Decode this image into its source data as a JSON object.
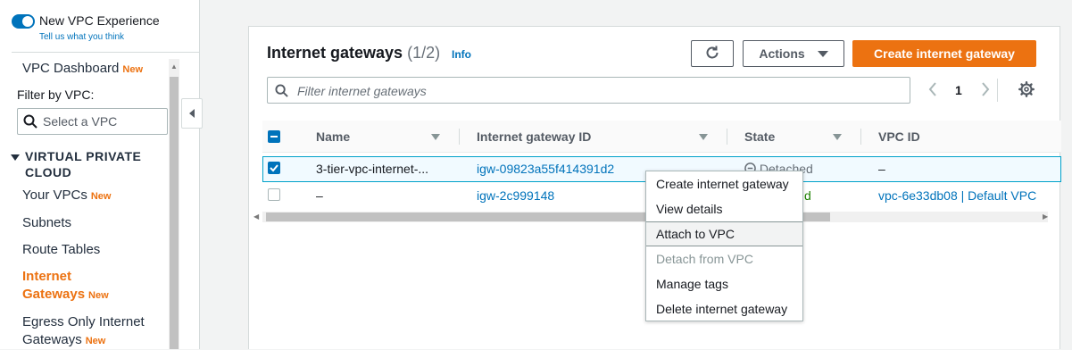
{
  "sidebar": {
    "toggle_label": "New VPC Experience",
    "feedback_link": "Tell us what you think",
    "dashboard_label": "VPC Dashboard",
    "new_badge": "New",
    "filter_label": "Filter by VPC:",
    "vpc_select_placeholder": "Select a VPC",
    "section_title_line1": "VIRTUAL PRIVATE",
    "section_title_line2": "CLOUD",
    "items": [
      {
        "label": "Your VPCs",
        "badge": "New"
      },
      {
        "label": "Subnets"
      },
      {
        "label": "Route Tables"
      },
      {
        "label_line1": "Internet",
        "label_line2": "Gateways",
        "badge": "New",
        "active": true
      },
      {
        "label_line1": "Egress Only Internet",
        "label_line2": "Gateways",
        "badge": "New"
      }
    ]
  },
  "panel": {
    "title": "Internet gateways",
    "count": "(1/2)",
    "info_link": "Info",
    "actions_label": "Actions",
    "create_label": "Create internet gateway",
    "filter_placeholder": "Filter internet gateways",
    "page_number": "1"
  },
  "table": {
    "headers": [
      "Name",
      "Internet gateway ID",
      "State",
      "VPC ID"
    ],
    "rows": [
      {
        "name": "3-tier-vpc-internet-...",
        "id": "igw-09823a55f414391d2",
        "state": "Detached",
        "vpc": "–",
        "selected": true
      },
      {
        "name": "–",
        "id": "igw-2c999148",
        "state": "d",
        "vpc": "vpc-6e33db08 | Default VPC",
        "selected": false
      }
    ]
  },
  "context_menu": {
    "items": [
      {
        "label": "Create internet gateway",
        "state": "normal"
      },
      {
        "label": "View details",
        "state": "normal"
      },
      {
        "label": "Attach to VPC",
        "state": "hover"
      },
      {
        "label": "Detach from VPC",
        "state": "disabled"
      },
      {
        "label": "Manage tags",
        "state": "normal"
      },
      {
        "label": "Delete internet gateway",
        "state": "normal"
      }
    ]
  },
  "colors": {
    "accent_orange": "#ec7211",
    "link_blue": "#0073bb",
    "selected_row": "#f1faff",
    "success_green": "#1d8102"
  },
  "icons": [
    "toggle-switch-icon",
    "search-icon",
    "refresh-icon",
    "caret-down-icon",
    "chevron-left-icon",
    "chevron-right-icon",
    "settings-gear-icon",
    "sort-icon",
    "status-stop-icon",
    "collapse-left-icon"
  ]
}
